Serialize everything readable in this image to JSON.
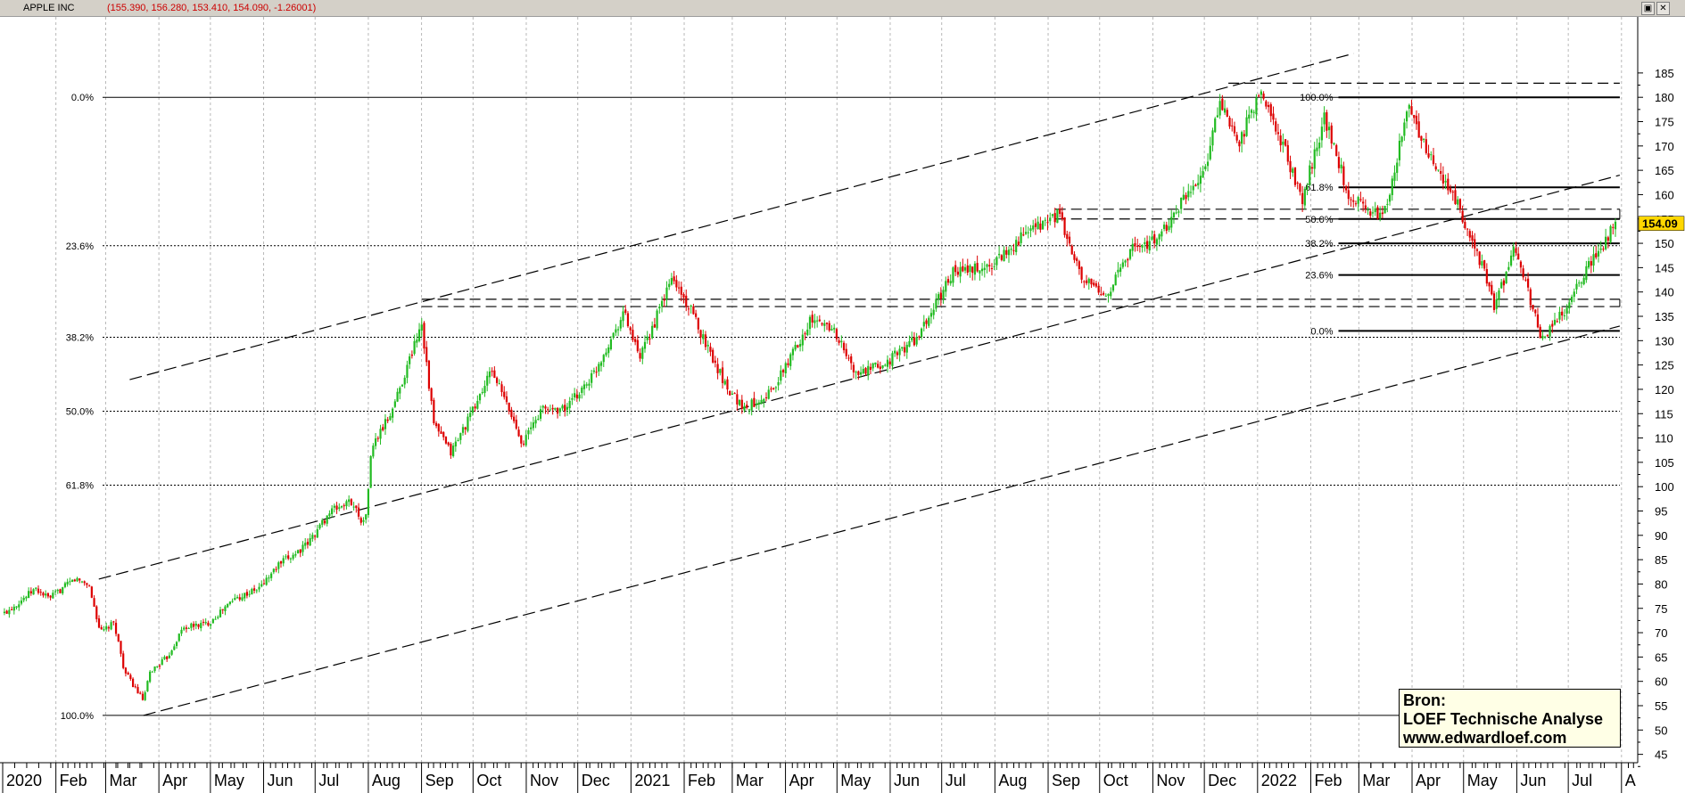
{
  "window": {
    "title": "APPLE INC",
    "ohlc": "(155.390, 156.280, 153.410, 154.090, -1.26001)",
    "buttons": [
      {
        "name": "window-restore-icon",
        "glyph": "▣"
      },
      {
        "name": "close-icon",
        "glyph": "✕"
      }
    ]
  },
  "source_box": {
    "line1": "Bron:",
    "line2": "LOEF Technische Analyse",
    "line3": "www.edwardloef.com"
  },
  "colors": {
    "up": "#22bb22",
    "down": "#dd0000",
    "last_price_bg": "#ffd700",
    "grid": "#b8b8b8",
    "background": "#ffffff"
  },
  "chart_data": {
    "type": "candlestick",
    "title": "APPLE INC",
    "last_price": "154.09",
    "ylim": [
      42,
      188
    ],
    "y_ticks": [
      45,
      50,
      55,
      60,
      65,
      70,
      75,
      80,
      85,
      90,
      95,
      100,
      105,
      110,
      115,
      120,
      125,
      130,
      135,
      140,
      145,
      150,
      155,
      160,
      165,
      170,
      175,
      180,
      185
    ],
    "x_months": [
      {
        "label": "2020",
        "date": "2020-01-01"
      },
      {
        "label": "Feb",
        "date": "2020-02-01"
      },
      {
        "label": "Mar",
        "date": "2020-03-01"
      },
      {
        "label": "Apr",
        "date": "2020-04-01"
      },
      {
        "label": "May",
        "date": "2020-05-01"
      },
      {
        "label": "Jun",
        "date": "2020-06-01"
      },
      {
        "label": "Jul",
        "date": "2020-07-01"
      },
      {
        "label": "Aug",
        "date": "2020-08-01"
      },
      {
        "label": "Sep",
        "date": "2020-09-01"
      },
      {
        "label": "Oct",
        "date": "2020-10-01"
      },
      {
        "label": "Nov",
        "date": "2020-11-01"
      },
      {
        "label": "Dec",
        "date": "2020-12-01"
      },
      {
        "label": "2021",
        "date": "2021-01-01"
      },
      {
        "label": "Feb",
        "date": "2021-02-01"
      },
      {
        "label": "Mar",
        "date": "2021-03-01"
      },
      {
        "label": "Apr",
        "date": "2021-04-01"
      },
      {
        "label": "May",
        "date": "2021-05-01"
      },
      {
        "label": "Jun",
        "date": "2021-06-01"
      },
      {
        "label": "Jul",
        "date": "2021-07-01"
      },
      {
        "label": "Aug",
        "date": "2021-08-01"
      },
      {
        "label": "Sep",
        "date": "2021-09-01"
      },
      {
        "label": "Oct",
        "date": "2021-10-01"
      },
      {
        "label": "Nov",
        "date": "2021-11-01"
      },
      {
        "label": "Dec",
        "date": "2021-12-01"
      },
      {
        "label": "2022",
        "date": "2022-01-01"
      },
      {
        "label": "Feb",
        "date": "2022-02-01"
      },
      {
        "label": "Mar",
        "date": "2022-03-01"
      },
      {
        "label": "Apr",
        "date": "2022-04-01"
      },
      {
        "label": "May",
        "date": "2022-05-01"
      },
      {
        "label": "Jun",
        "date": "2022-06-01"
      },
      {
        "label": "Jul",
        "date": "2022-07-01"
      },
      {
        "label": "A",
        "date": "2022-08-01"
      }
    ],
    "price_path": [
      [
        "2020-01-02",
        74
      ],
      [
        "2020-01-20",
        79
      ],
      [
        "2020-01-28",
        77
      ],
      [
        "2020-02-12",
        81
      ],
      [
        "2020-02-20",
        80
      ],
      [
        "2020-02-27",
        70
      ],
      [
        "2020-03-06",
        72
      ],
      [
        "2020-03-12",
        62
      ],
      [
        "2020-03-23",
        56
      ],
      [
        "2020-03-27",
        62
      ],
      [
        "2020-04-06",
        65
      ],
      [
        "2020-04-15",
        71
      ],
      [
        "2020-04-30",
        72
      ],
      [
        "2020-05-15",
        77
      ],
      [
        "2020-05-29",
        79
      ],
      [
        "2020-06-10",
        84
      ],
      [
        "2020-06-26",
        88
      ],
      [
        "2020-07-10",
        95
      ],
      [
        "2020-07-22",
        97
      ],
      [
        "2020-07-30",
        92
      ],
      [
        "2020-08-03",
        108
      ],
      [
        "2020-08-14",
        115
      ],
      [
        "2020-08-24",
        125
      ],
      [
        "2020-09-01",
        134
      ],
      [
        "2020-09-08",
        113
      ],
      [
        "2020-09-18",
        107
      ],
      [
        "2020-09-30",
        115
      ],
      [
        "2020-10-12",
        124
      ],
      [
        "2020-10-30",
        109
      ],
      [
        "2020-11-10",
        116
      ],
      [
        "2020-11-24",
        116
      ],
      [
        "2020-12-10",
        123
      ],
      [
        "2020-12-28",
        136
      ],
      [
        "2021-01-06",
        126
      ],
      [
        "2021-01-25",
        143
      ],
      [
        "2021-02-05",
        136
      ],
      [
        "2021-02-25",
        121
      ],
      [
        "2021-03-08",
        116
      ],
      [
        "2021-03-25",
        120
      ],
      [
        "2021-04-15",
        134
      ],
      [
        "2021-04-28",
        133
      ],
      [
        "2021-05-12",
        123
      ],
      [
        "2021-05-28",
        125
      ],
      [
        "2021-06-18",
        131
      ],
      [
        "2021-07-07",
        144
      ],
      [
        "2021-07-28",
        145
      ],
      [
        "2021-08-16",
        151
      ],
      [
        "2021-09-07",
        156
      ],
      [
        "2021-09-20",
        143
      ],
      [
        "2021-10-04",
        139
      ],
      [
        "2021-10-20",
        149
      ],
      [
        "2021-11-05",
        151
      ],
      [
        "2021-11-22",
        161
      ],
      [
        "2021-12-01",
        165
      ],
      [
        "2021-12-10",
        179
      ],
      [
        "2021-12-20",
        170
      ],
      [
        "2022-01-03",
        181
      ],
      [
        "2022-01-14",
        172
      ],
      [
        "2022-01-27",
        159
      ],
      [
        "2022-02-09",
        176
      ],
      [
        "2022-02-23",
        160
      ],
      [
        "2022-03-08",
        157
      ],
      [
        "2022-03-15",
        155
      ],
      [
        "2022-03-30",
        178
      ],
      [
        "2022-04-12",
        167
      ],
      [
        "2022-04-29",
        157
      ],
      [
        "2022-05-11",
        146
      ],
      [
        "2022-05-19",
        137
      ],
      [
        "2022-05-31",
        149
      ],
      [
        "2022-06-10",
        137
      ],
      [
        "2022-06-16",
        130
      ],
      [
        "2022-06-30",
        137
      ],
      [
        "2022-07-12",
        145
      ],
      [
        "2022-07-29",
        154
      ]
    ],
    "trendlines": [
      {
        "name": "upper-channel-line",
        "from": [
          "2020-03-15",
          122
        ],
        "to": [
          "2022-02-26",
          189
        ]
      },
      {
        "name": "middle-channel-line",
        "from": [
          "2020-02-26",
          81
        ],
        "to": [
          "2022-07-31",
          164
        ]
      },
      {
        "name": "lower-channel-line",
        "from": [
          "2020-03-23",
          53
        ],
        "to": [
          "2022-07-31",
          133
        ]
      }
    ],
    "resistance_lines": [
      {
        "from": "2020-09-01",
        "to": "2022-07-31",
        "values": [
          138.5,
          137
        ]
      },
      {
        "from": "2021-09-05",
        "to": "2022-07-31",
        "values": [
          157,
          155
        ]
      },
      {
        "from": "2021-12-15",
        "to": "2022-07-31",
        "values": [
          182.9
        ]
      }
    ],
    "fib_long": {
      "from": "2020-03-23",
      "to": "2022-07-31",
      "levels": [
        {
          "label": "0.0%",
          "value": 180
        },
        {
          "label": "23.6%",
          "value": 149.5
        },
        {
          "label": "38.2%",
          "value": 130.7
        },
        {
          "label": "50.0%",
          "value": 115.5
        },
        {
          "label": "61.8%",
          "value": 100.3
        },
        {
          "label": "100.0%",
          "value": 53
        }
      ]
    },
    "fib_short": {
      "from": "2022-02-14",
      "to": "2022-07-31",
      "levels": [
        {
          "label": "100.0%",
          "value": 180
        },
        {
          "label": "61.8%",
          "value": 161.5
        },
        {
          "label": "50.0%",
          "value": 155
        },
        {
          "label": "38.2%",
          "value": 150
        },
        {
          "label": "23.6%",
          "value": 143.5
        },
        {
          "label": "0.0%",
          "value": 132
        }
      ]
    }
  }
}
